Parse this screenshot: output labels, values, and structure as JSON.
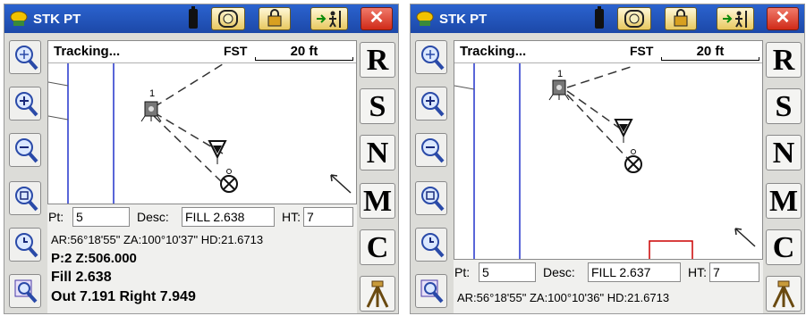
{
  "screens": [
    {
      "title": "STK PT",
      "status_text": "Tracking...",
      "mode": "FST",
      "scale": "20 ft",
      "point_label": "1",
      "fields": {
        "pt_label": "Pt:",
        "pt_value": "5",
        "desc_label": "Desc:",
        "desc_value": "FILL 2.638",
        "ht_label": "HT:",
        "ht_value": "7"
      },
      "angles": "AR:56°18'55\"  ZA:100°10'37\" HD:21.6713",
      "lines": [
        "P:2 Z:506.000",
        "Fill 2.638",
        "Out 7.191 Right 7.949"
      ]
    },
    {
      "title": "STK PT",
      "status_text": "Tracking...",
      "mode": "FST",
      "scale": "20 ft",
      "point_label": "1",
      "fields": {
        "pt_label": "Pt:",
        "pt_value": "5",
        "desc_label": "Desc:",
        "desc_value": "FILL 2.637",
        "ht_label": "HT:",
        "ht_value": "7"
      },
      "angles": "AR:56°18'55\"  ZA:100°10'36\" HD:21.6713",
      "lines": []
    }
  ],
  "right_buttons": [
    "R",
    "S",
    "N",
    "M",
    "C"
  ],
  "left_buttons": [
    "zoom-extents-icon",
    "zoom-in-icon",
    "zoom-out-icon",
    "zoom-window-icon",
    "zoom-previous-icon",
    "zoom-point-icon"
  ],
  "colors": {
    "titlebar": "#1f4fb4",
    "close": "#d83020",
    "map_line": "#2233cc",
    "marker": "#cc0000"
  }
}
